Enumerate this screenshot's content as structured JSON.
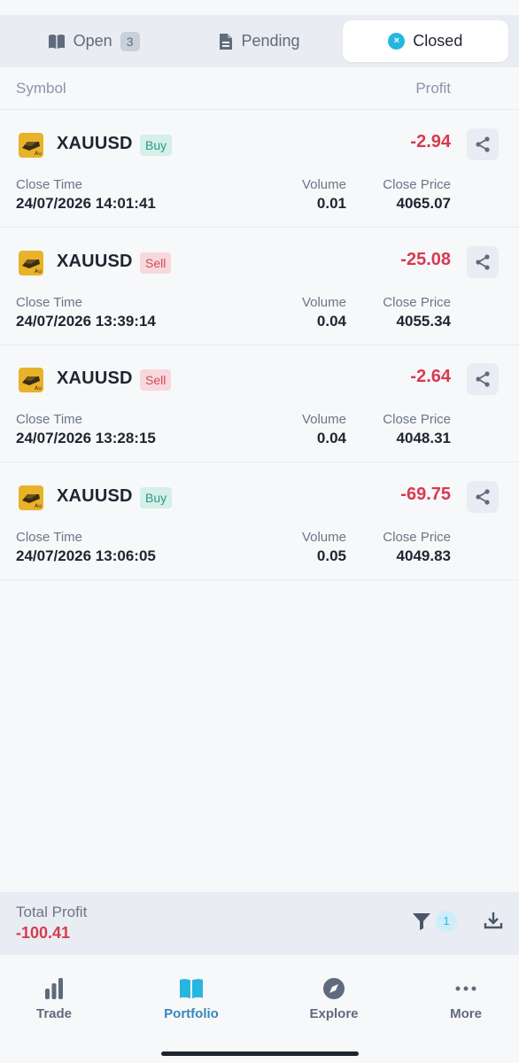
{
  "tabs": [
    {
      "label": "Open",
      "count": "3"
    },
    {
      "label": "Pending"
    },
    {
      "label": "Closed",
      "close_glyph": "×"
    }
  ],
  "columns": {
    "symbol": "Symbol",
    "profit": "Profit"
  },
  "trades": [
    {
      "symbol": "XAUUSD",
      "side": "Buy",
      "profit": "-2.94",
      "close_time_label": "Close Time",
      "close_time": "24/07/2026 14:01:41",
      "volume_label": "Volume",
      "volume": "0.01",
      "close_price_label": "Close Price",
      "close_price": "4065.07"
    },
    {
      "symbol": "XAUUSD",
      "side": "Sell",
      "profit": "-25.08",
      "close_time_label": "Close Time",
      "close_time": "24/07/2026 13:39:14",
      "volume_label": "Volume",
      "volume": "0.04",
      "close_price_label": "Close Price",
      "close_price": "4055.34"
    },
    {
      "symbol": "XAUUSD",
      "side": "Sell",
      "profit": "-2.64",
      "close_time_label": "Close Time",
      "close_time": "24/07/2026 13:28:15",
      "volume_label": "Volume",
      "volume": "0.04",
      "close_price_label": "Close Price",
      "close_price": "4048.31"
    },
    {
      "symbol": "XAUUSD",
      "side": "Buy",
      "profit": "-69.75",
      "close_time_label": "Close Time",
      "close_time": "24/07/2026 13:06:05",
      "volume_label": "Volume",
      "volume": "0.05",
      "close_price_label": "Close Price",
      "close_price": "4049.83"
    }
  ],
  "total": {
    "label": "Total Profit",
    "value": "-100.41",
    "filter_count": "1"
  },
  "nav": [
    {
      "label": "Trade",
      "icon": "bar-chart-icon"
    },
    {
      "label": "Portfolio",
      "icon": "book-icon",
      "active": true
    },
    {
      "label": "Explore",
      "icon": "compass-icon"
    },
    {
      "label": "More",
      "icon": "more-dots-icon"
    }
  ],
  "colors": {
    "loss": "#d73a4e",
    "accent": "#28b6e0",
    "buy": "#2d9886",
    "sell": "#d54a5a"
  }
}
